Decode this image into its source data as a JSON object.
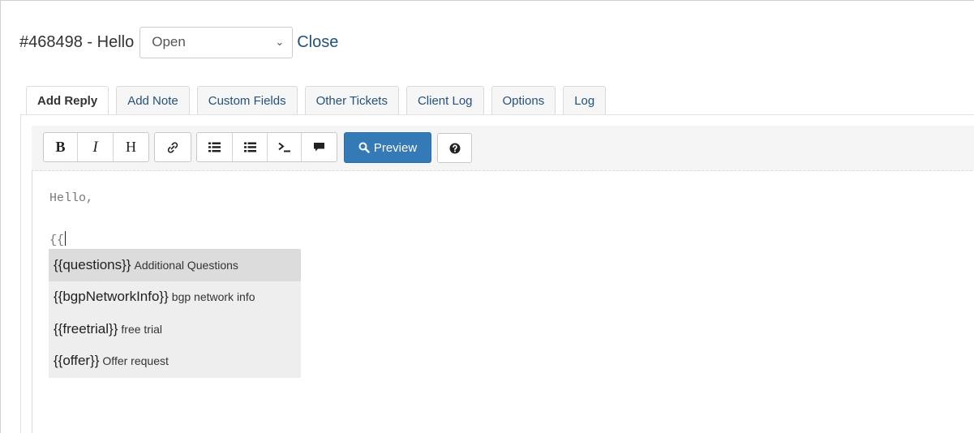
{
  "ticket": {
    "title": "#468498 - Hello",
    "status_value": "Open",
    "close_label": "Close"
  },
  "tabs": [
    {
      "label": "Add Reply",
      "active": true
    },
    {
      "label": "Add Note"
    },
    {
      "label": "Custom Fields"
    },
    {
      "label": "Other Tickets"
    },
    {
      "label": "Client Log"
    },
    {
      "label": "Options"
    },
    {
      "label": "Log"
    }
  ],
  "toolbar": {
    "bold": "B",
    "italic": "I",
    "heading": "H",
    "preview_label": "Preview",
    "icons": [
      "link-icon",
      "unordered-list-icon",
      "ordered-list-icon",
      "code-icon",
      "quote-icon",
      "search-icon",
      "question-circle-icon"
    ]
  },
  "editor": {
    "line1": "Hello,",
    "line2": "{{"
  },
  "autocomplete": [
    {
      "key": "{{questions}}",
      "desc": "Additional Questions",
      "selected": true
    },
    {
      "key": "{{bgpNetworkInfo}}",
      "desc": "bgp network info"
    },
    {
      "key": "{{freetrial}}",
      "desc": "free trial"
    },
    {
      "key": "{{offer}}",
      "desc": "Offer request"
    }
  ],
  "colors": {
    "link": "#23527c",
    "primary": "#337ab7",
    "autocomplete_bg": "#eeeeee"
  }
}
